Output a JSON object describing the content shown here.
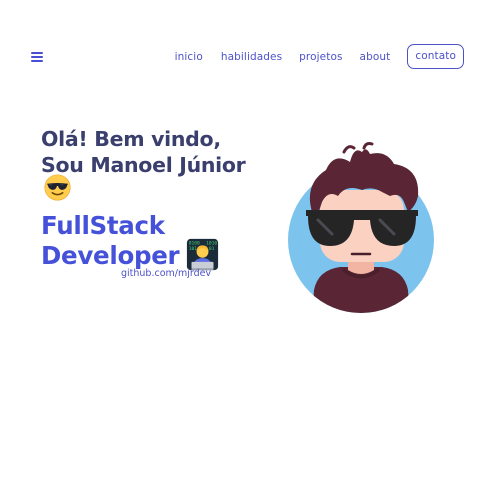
{
  "nav": {
    "items": [
      {
        "label": "inicio"
      },
      {
        "label": "habilidades"
      },
      {
        "label": "projetos"
      },
      {
        "label": "about"
      }
    ],
    "cta_label": "contato",
    "menu_icon": "hamburger-menu-icon"
  },
  "hero": {
    "greeting_line1": "Olá! Bem vindo,",
    "greeting_line2": "Sou Manoel Júnior",
    "greeting_emoji": "smiling-face-with-sunglasses-icon",
    "role_line1": "FullStack",
    "role_line2": "Developer",
    "role_emoji": "technologist-icon",
    "github_text": "github.com/mjrdev"
  },
  "colors": {
    "primary": "#4d52c9",
    "heading": "#3a3f6e",
    "role": "#4451d8",
    "avatar_bg": "#7cc4ee",
    "hair": "#5a2635",
    "skin": "#fbd2c2",
    "shirt": "#5a2635"
  }
}
